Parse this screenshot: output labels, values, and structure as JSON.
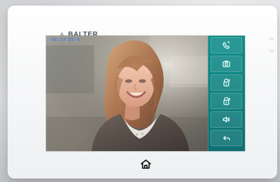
{
  "brand": {
    "name": "BALTER"
  },
  "screen": {
    "status_text": "00:23  DS-4"
  },
  "controls": {
    "items": [
      {
        "name": "answer",
        "icon": "handset-icon"
      },
      {
        "name": "snapshot",
        "icon": "camera-icon"
      },
      {
        "name": "unlock-1",
        "icon": "unlock-1-icon",
        "sup": "1"
      },
      {
        "name": "unlock-2",
        "icon": "unlock-2-icon",
        "sup": "2"
      },
      {
        "name": "volume",
        "icon": "speaker-icon"
      },
      {
        "name": "back",
        "icon": "back-arrow-icon"
      }
    ]
  },
  "nav": {
    "home_icon": "home-icon"
  },
  "colors": {
    "controls_bg": "#118f8b",
    "status_text": "#1f5bd8",
    "device_bezel": "#ffffff"
  }
}
